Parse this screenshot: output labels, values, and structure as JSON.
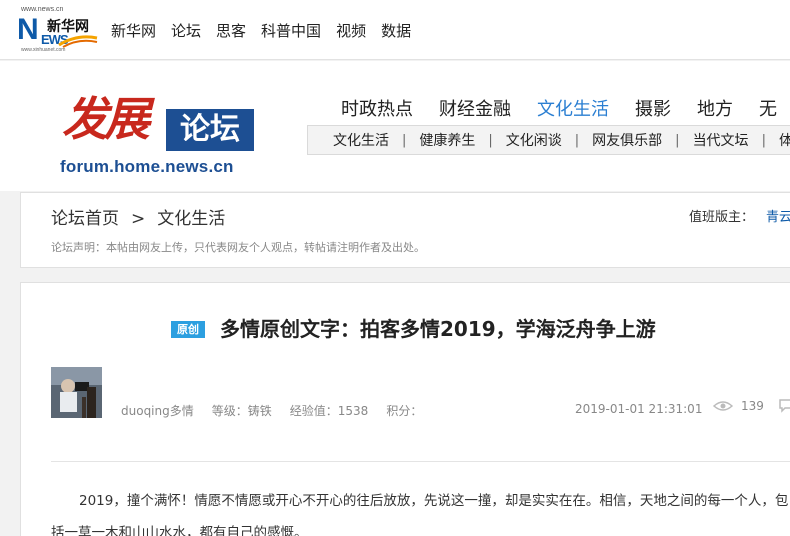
{
  "site": {
    "logo_url_text": "www.news.cn",
    "logo_name": "新华网",
    "logo_big": "N",
    "logo_ews": "EWS",
    "logo_sub": "www.xinhuanet.com"
  },
  "top_nav": [
    "新华网",
    "论坛",
    "思客",
    "科普中国",
    "视频",
    "数据"
  ],
  "forum": {
    "logo_text": "发展",
    "logo_box": "论坛",
    "logo_url": "forum.home.news.cn"
  },
  "main_nav": [
    "时政热点",
    "财经金融",
    "文化生活",
    "摄影",
    "地方",
    "无"
  ],
  "main_nav_active": "文化生活",
  "sub_nav": [
    "文化生活",
    "健康养生",
    "文化闲谈",
    "网友俱乐部",
    "当代文坛",
    "体"
  ],
  "breadcrumb": {
    "home": "论坛首页",
    "arrow": ">",
    "current": "文化生活",
    "declaration": "论坛声明：本帖由网友上传，只代表网友个人观点，转帖请注明作者及出处。",
    "moderator_label": "值班版主：",
    "moderator_value": "青云"
  },
  "post": {
    "badge": "原创",
    "title": "多情原创文字：拍客多情2019，学海泛舟争上游",
    "author": "duoqing多情",
    "level": "等级：铸铁",
    "exp": "经验值：1538",
    "points": "积分：",
    "date": "2019-01-01 21:31:01",
    "views": "139",
    "body_line1": "2019，撞个满怀！情愿不情愿或开心不开心的往后放放，先说这一撞，却是实实在在。相信，天地之间的每一个人，包",
    "body_line2": "括一草一木和山山水水，都有自己的感慨。"
  },
  "colors": {
    "brand_blue": "#1d4f93",
    "brand_red": "#c8281d",
    "active_nav": "#2b7fd2",
    "badge_bg": "#2c9fe0"
  }
}
